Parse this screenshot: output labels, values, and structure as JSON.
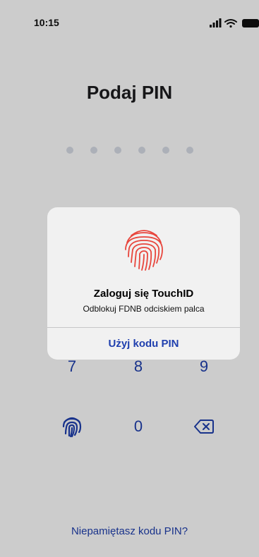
{
  "status_bar": {
    "time": "10:15",
    "icons": [
      "signal-icon",
      "wifi-icon",
      "battery-icon"
    ]
  },
  "pin_screen": {
    "title": "Podaj PIN",
    "pin_length": 6,
    "keypad": {
      "row_789": [
        "7",
        "8",
        "9"
      ],
      "zero": "0",
      "biometric_icon": "fingerprint-icon",
      "delete_icon": "backspace-icon"
    },
    "forgot_link": "Niepamiętasz kodu PIN?"
  },
  "touchid_alert": {
    "icon": "fingerprint-icon",
    "title": "Zaloguj się TouchID",
    "subtitle": "Odblokuj FDNB odciskiem palca",
    "button_label": "Użyj kodu PIN"
  },
  "colors": {
    "accent": "#1f3fae",
    "fingerprint_red": "#e8453c",
    "dot_empty": "#d7dce6",
    "overlay": "rgba(0,0,0,0.2)"
  }
}
